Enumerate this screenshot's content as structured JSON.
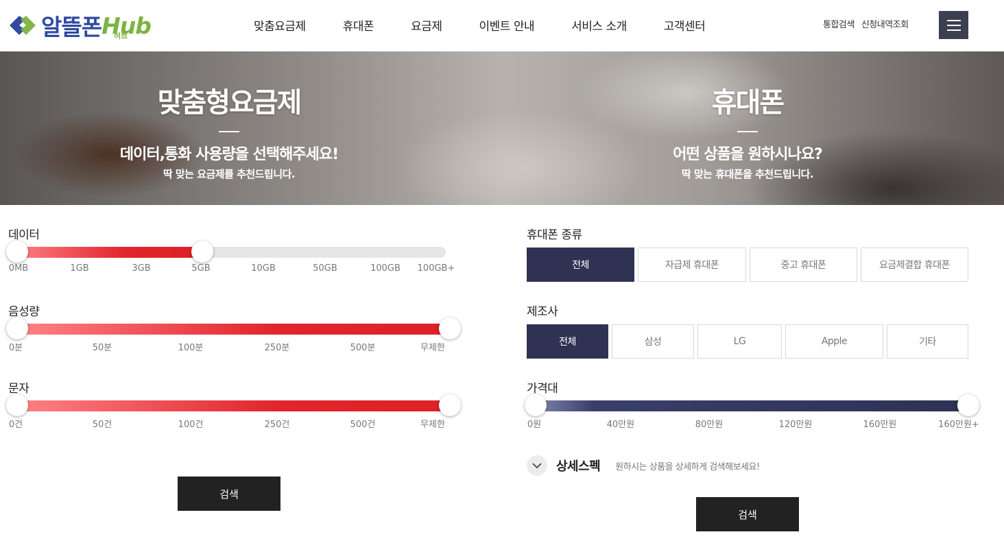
{
  "header": {
    "logo_text": "알뜰폰",
    "logo_hub": "Hub",
    "logo_sub": "허브",
    "nav": [
      "맞춤요금제",
      "휴대폰",
      "요금제",
      "이벤트 안내",
      "서비스 소개",
      "고객센터"
    ],
    "util": [
      "통합검색",
      "신청내역조회"
    ]
  },
  "hero": {
    "left": {
      "title": "맞춤형요금제",
      "subtitle": "데이터,통화 사용량을 선택해주세요!",
      "desc": "딱 맞는 요금제를 추천드립니다."
    },
    "right": {
      "title": "휴대폰",
      "subtitle": "어떤 상품을 원하시나요?",
      "desc": "딱 맞는 휴대폰을 추천드립니다."
    }
  },
  "plan_filter": {
    "data": {
      "label": "데이터",
      "ticks": [
        "0MB",
        "1GB",
        "3GB",
        "5GB",
        "10GB",
        "50GB",
        "100GB",
        "100GB+"
      ],
      "selected_min_index": 0,
      "selected_max_index": 3
    },
    "voice": {
      "label": "음성량",
      "ticks": [
        "0분",
        "50분",
        "100분",
        "250분",
        "500분",
        "무제한"
      ],
      "selected_min_index": 0,
      "selected_max_index": 5
    },
    "sms": {
      "label": "문자",
      "ticks": [
        "0건",
        "50건",
        "100건",
        "250건",
        "500건",
        "무제한"
      ],
      "selected_min_index": 0,
      "selected_max_index": 5
    },
    "search_label": "검색"
  },
  "phone_filter": {
    "type": {
      "label": "휴대폰 종류",
      "options": [
        "전체",
        "자급제 휴대폰",
        "중고 휴대폰",
        "요금제결합 휴대폰"
      ],
      "selected": "전체"
    },
    "maker": {
      "label": "제조사",
      "options": [
        "전체",
        "삼성",
        "LG",
        "Apple",
        "기타"
      ],
      "selected": "전체"
    },
    "price": {
      "label": "가격대",
      "ticks": [
        "0원",
        "40만원",
        "80만원",
        "120만원",
        "160만원",
        "160만원+"
      ],
      "selected_min_index": 0,
      "selected_max_index": 5
    },
    "spec": {
      "title": "상세스펙",
      "desc": "원하시는 상품을 상세하게 검색해보세요!"
    },
    "search_label": "검색"
  },
  "colors": {
    "accent_red": "#e1252c",
    "navy": "#2f3252",
    "dark_button": "#222222",
    "logo_blue": "#2f4aa0",
    "logo_green": "#7cb342"
  }
}
